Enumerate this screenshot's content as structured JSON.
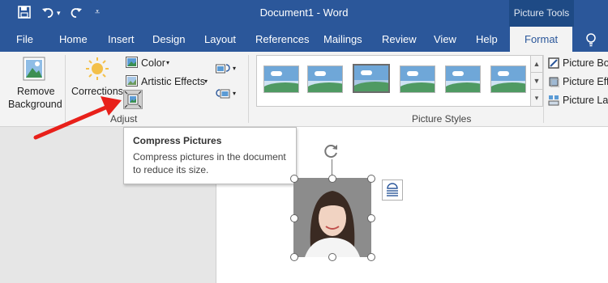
{
  "titlebar": {
    "title": "Document1  -  Word",
    "context_tab": "Picture Tools"
  },
  "tabs": [
    "File",
    "Home",
    "Insert",
    "Design",
    "Layout",
    "References",
    "Mailings",
    "Review",
    "View",
    "Help",
    "Format"
  ],
  "ribbon": {
    "remove_background": [
      "Remove",
      "Background"
    ],
    "corrections": "Corrections",
    "color": "Color",
    "artistic_effects": "Artistic Effects",
    "adjust_group": "Adjust",
    "picture_styles_group": "Picture Styles",
    "picture_border": "Picture Bor",
    "picture_effects": "Picture Effe",
    "picture_layout": "Picture Lay"
  },
  "tooltip": {
    "title": "Compress Pictures",
    "description": "Compress pictures in the document to reduce its size."
  },
  "colors": {
    "brand": "#2b579a",
    "arrow": "#e8201a"
  }
}
